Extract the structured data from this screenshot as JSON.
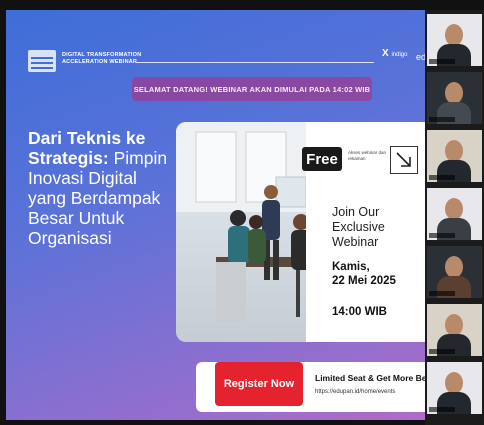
{
  "slide": {
    "brand": [
      "DIGITAL TRANSFORMATION",
      "ACCELERATION WEBINAR"
    ],
    "partner_mark": "X",
    "partner_mark_sub": "indigo",
    "partner_text": "edu",
    "banner": "SELAMAT DATANG! WEBINAR AKAN DIMULAI PADA 14:02 WIB",
    "headline_bold": "Dari Teknis ke Strategis:",
    "headline_rest": "Pimpin Inovasi Digital yang Berdampak Besar Untuk Organisasi",
    "free_label": "Free",
    "free_note": "Akses webinar dan rekaman",
    "join_text": "Join Our Exclusive Webinar",
    "date_line1": "Kamis,",
    "date_line2": "22 Mei 2025",
    "time": "14:00 WIB",
    "register_label": "Register Now",
    "limited_text": "Limited Seat & Get More Benefits",
    "url": "https://edupan.id/home/events"
  },
  "participants": [
    {
      "id": "p1",
      "style": "light"
    },
    {
      "id": "p2",
      "style": "dark"
    },
    {
      "id": "p3",
      "style": "wall"
    },
    {
      "id": "p4",
      "style": "light"
    },
    {
      "id": "p5",
      "style": "dark"
    },
    {
      "id": "p6",
      "style": "wall"
    },
    {
      "id": "p7",
      "style": "light"
    }
  ],
  "colors": {
    "accent": "#3e6ed8",
    "register": "#e4232e"
  }
}
